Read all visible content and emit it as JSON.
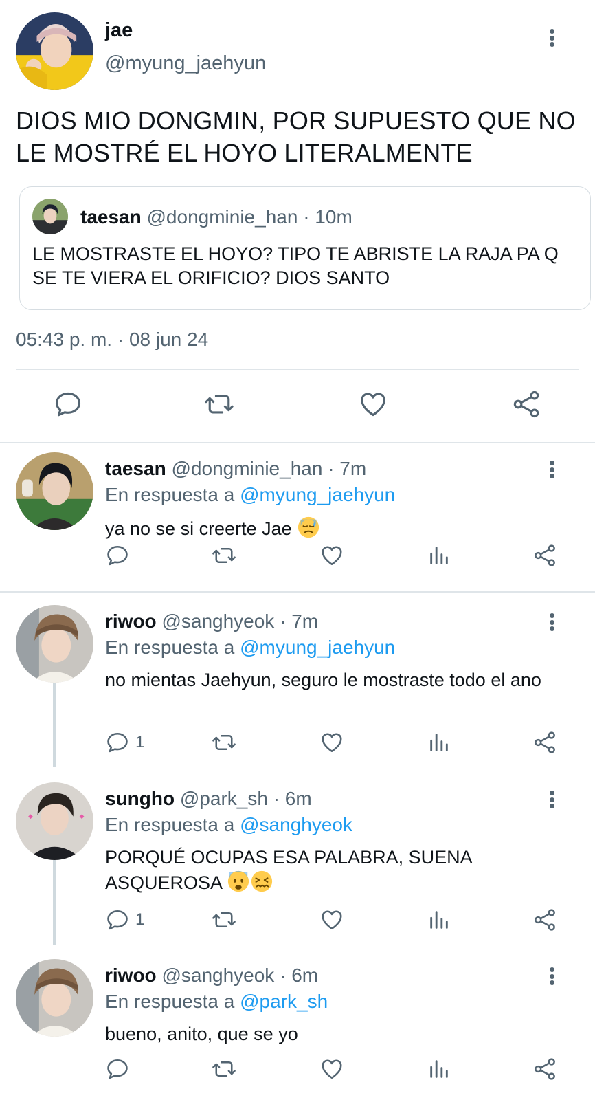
{
  "main_tweet": {
    "name": "jae",
    "handle": "@myung_jaehyun",
    "text": "DIOS MIO DONGMIN, POR SUPUESTO QUE NO LE MOSTRÉ EL HOYO LITERALMENTE",
    "timestamp": "05:43 p. m. · 08 jun 24",
    "quote": {
      "name": "taesan",
      "handle": "@dongminie_han",
      "time": "· 10m",
      "text": "LE MOSTRASTE EL HOYO? TIPO TE ABRISTE LA RAJA PA Q SE TE VIERA EL ORIFICIO? DIOS SANTO"
    }
  },
  "replies": [
    {
      "name": "taesan",
      "handle": "@dongminie_han",
      "time": "· 7m",
      "reply_prefix": "En respuesta a",
      "reply_to": "@myung_jaehyun",
      "text": "ya no se si creerte Jae",
      "emoji": [
        "sweat-emoji"
      ],
      "reply_count": ""
    },
    {
      "name": "riwoo",
      "handle": "@sanghyeok",
      "time": "· 7m",
      "reply_prefix": "En respuesta a",
      "reply_to": "@myung_jaehyun",
      "text": "no mientas Jaehyun, seguro le mostraste todo el ano",
      "reply_count": "1"
    },
    {
      "name": "sungho",
      "handle": "@park_sh",
      "time": "· 6m",
      "reply_prefix": "En respuesta a",
      "reply_to": "@sanghyeok",
      "text": "PORQUÉ OCUPAS ESA PALABRA, SUENA ASQUEROSA",
      "emoji": [
        "fearful-emoji",
        "confounded-emoji"
      ],
      "reply_count": "1"
    },
    {
      "name": "riwoo",
      "handle": "@sanghyeok",
      "time": "· 6m",
      "reply_prefix": "En respuesta a",
      "reply_to": "@park_sh",
      "text": "bueno, anito, que se yo",
      "reply_count": ""
    }
  ],
  "icons": {
    "reply": "reply-icon",
    "retweet": "retweet-icon",
    "like": "heart-icon",
    "views": "views-icon",
    "share": "share-icon",
    "more": "more-icon"
  },
  "colors": {
    "text": "#0f1419",
    "muted": "#536471",
    "link": "#1d9bf0",
    "divider": "#dfe5e9",
    "thread_line": "#cfd9de"
  }
}
